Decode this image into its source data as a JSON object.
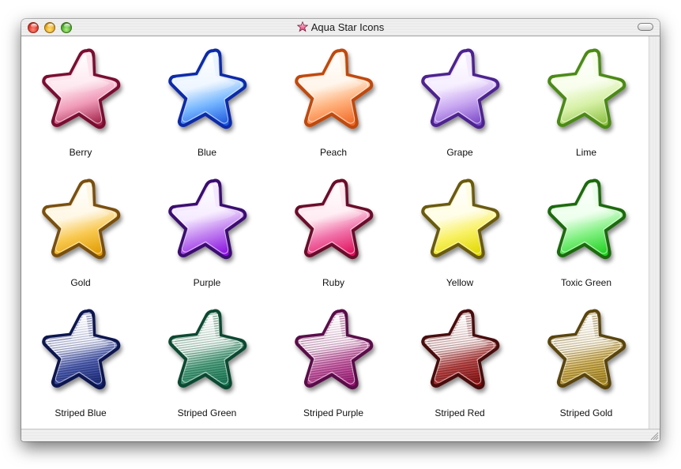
{
  "window": {
    "title": "Aqua Star Icons",
    "title_icon": "star-icon"
  },
  "icons": [
    {
      "label": "Berry",
      "light": "#fde3ec",
      "mid": "#f09ab8",
      "dark": "#a02048",
      "rim": "#7a1030",
      "striped": false
    },
    {
      "label": "Blue",
      "light": "#eaf4ff",
      "mid": "#78b8ff",
      "dark": "#1e5ae0",
      "rim": "#0a2aa8",
      "striped": false
    },
    {
      "label": "Peach",
      "light": "#fff3e6",
      "mid": "#ffb07a",
      "dark": "#f06a28",
      "rim": "#c04a10",
      "striped": false
    },
    {
      "label": "Grape",
      "light": "#f3eaff",
      "mid": "#c8a6f0",
      "dark": "#7a48c8",
      "rim": "#4e2290",
      "striped": false
    },
    {
      "label": "Lime",
      "light": "#f6fde8",
      "mid": "#d6f0a6",
      "dark": "#8cc040",
      "rim": "#4c8a18",
      "striped": false
    },
    {
      "label": "Gold",
      "light": "#fff6e0",
      "mid": "#f8c850",
      "dark": "#e09a00",
      "rim": "#7a5010",
      "striped": false
    },
    {
      "label": "Purple",
      "light": "#f4e8ff",
      "mid": "#c080f0",
      "dark": "#8a10e0",
      "rim": "#3a0a70",
      "striped": false
    },
    {
      "label": "Ruby",
      "light": "#ffe8f0",
      "mid": "#f070a8",
      "dark": "#e0105a",
      "rim": "#6a0a2a",
      "striped": false
    },
    {
      "label": "Yellow",
      "light": "#fffde0",
      "mid": "#f8f060",
      "dark": "#e0d800",
      "rim": "#6a5a08",
      "striped": false
    },
    {
      "label": "Toxic Green",
      "light": "#eaffea",
      "mid": "#80f080",
      "dark": "#20d020",
      "rim": "#1a6a10",
      "striped": false
    },
    {
      "label": "Striped Blue",
      "light": "#f2f4ff",
      "mid": "#5a6ab8",
      "dark": "#1a2a7a",
      "rim": "#0a1450",
      "striped": true
    },
    {
      "label": "Striped Green",
      "light": "#eef8f2",
      "mid": "#5aa888",
      "dark": "#1a7a58",
      "rim": "#0c4a30",
      "striped": true
    },
    {
      "label": "Striped Purple",
      "light": "#fbeef6",
      "mid": "#d070b0",
      "dark": "#a01878",
      "rim": "#5a0a48",
      "striped": true
    },
    {
      "label": "Striped Red",
      "light": "#fbecec",
      "mid": "#c05050",
      "dark": "#8a1010",
      "rim": "#4a0808",
      "striped": true
    },
    {
      "label": "Striped Gold",
      "light": "#fbf4e2",
      "mid": "#d6b860",
      "dark": "#a88a20",
      "rim": "#5a4410",
      "striped": true
    }
  ]
}
